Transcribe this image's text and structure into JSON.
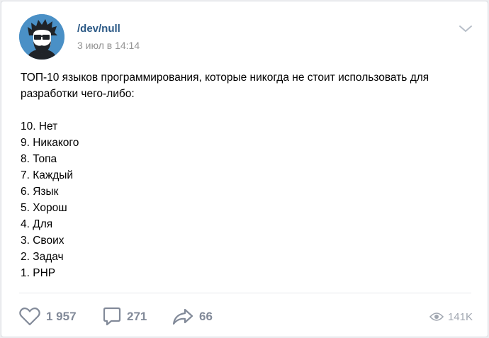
{
  "post": {
    "author": "/dev/null",
    "date": "3 июл в 14:14",
    "text_lines": [
      "ТОП-10 языков программирования, которые никогда не стоит использовать для",
      "разработки чего-либо:",
      "",
      "10. Нет",
      "9. Никакого",
      "8. Топа",
      "7. Каждый",
      "6. Язык",
      "5. Хорош",
      "4. Для",
      "3. Своих",
      "2. Задач",
      "1. PHP"
    ]
  },
  "actions": {
    "likes": "1 957",
    "comments": "271",
    "shares": "66",
    "views": "141K"
  },
  "icons": {
    "like": "heart-icon",
    "comment": "comment-icon",
    "share": "share-arrow-icon",
    "views": "eye-icon",
    "menu": "chevron-down-icon"
  },
  "colors": {
    "author_link": "#2a5885",
    "meta_gray": "#939393",
    "icon_gray": "#828a99",
    "avatar_bg": "#4a90c6"
  }
}
